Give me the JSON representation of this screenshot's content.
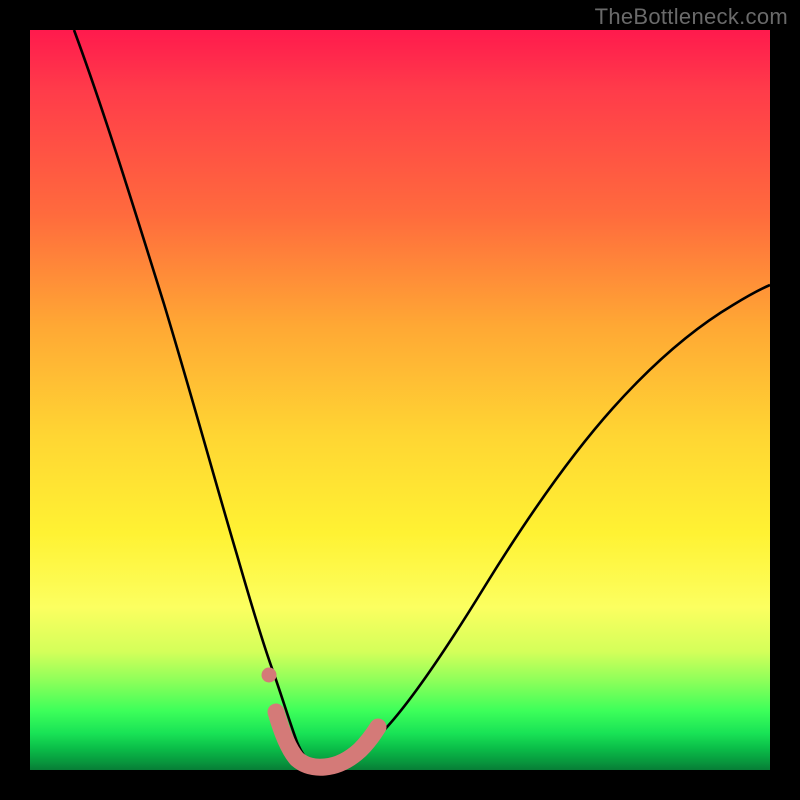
{
  "watermark": "TheBottleneck.com",
  "chart_data": {
    "type": "line",
    "title": "",
    "xlabel": "",
    "ylabel": "",
    "xlim": [
      0,
      100
    ],
    "ylim": [
      0,
      100
    ],
    "series": [
      {
        "name": "bottleneck-curve",
        "color": "#000000",
        "x": [
          6,
          10,
          14,
          18,
          22,
          25,
          28,
          30,
          32,
          33.5,
          35,
          36.5,
          38,
          42,
          46,
          52,
          58,
          66,
          74,
          82,
          90,
          100
        ],
        "y": [
          100,
          89,
          76,
          63,
          50,
          39,
          29,
          21,
          13,
          8,
          3,
          1,
          0.5,
          1,
          3,
          9,
          17,
          28,
          39,
          48,
          56,
          64
        ]
      },
      {
        "name": "highlight-left-dot",
        "color": "#d47a78",
        "type": "scatter",
        "x": [
          32.3
        ],
        "y": [
          12.8
        ]
      },
      {
        "name": "highlight-bottom-band",
        "color": "#d47a78",
        "type": "line",
        "x": [
          33.2,
          34,
          35,
          36.5,
          38,
          40,
          42,
          44,
          45.3
        ],
        "y": [
          7.8,
          4.2,
          1.8,
          0.7,
          0.5,
          0.6,
          1.2,
          2.4,
          3.6
        ]
      }
    ],
    "background_gradient": {
      "top": "#ff1a4d",
      "mid_upper": "#ffa834",
      "mid": "#fff233",
      "mid_lower": "#8cff5a",
      "bottom": "#077d36"
    }
  }
}
